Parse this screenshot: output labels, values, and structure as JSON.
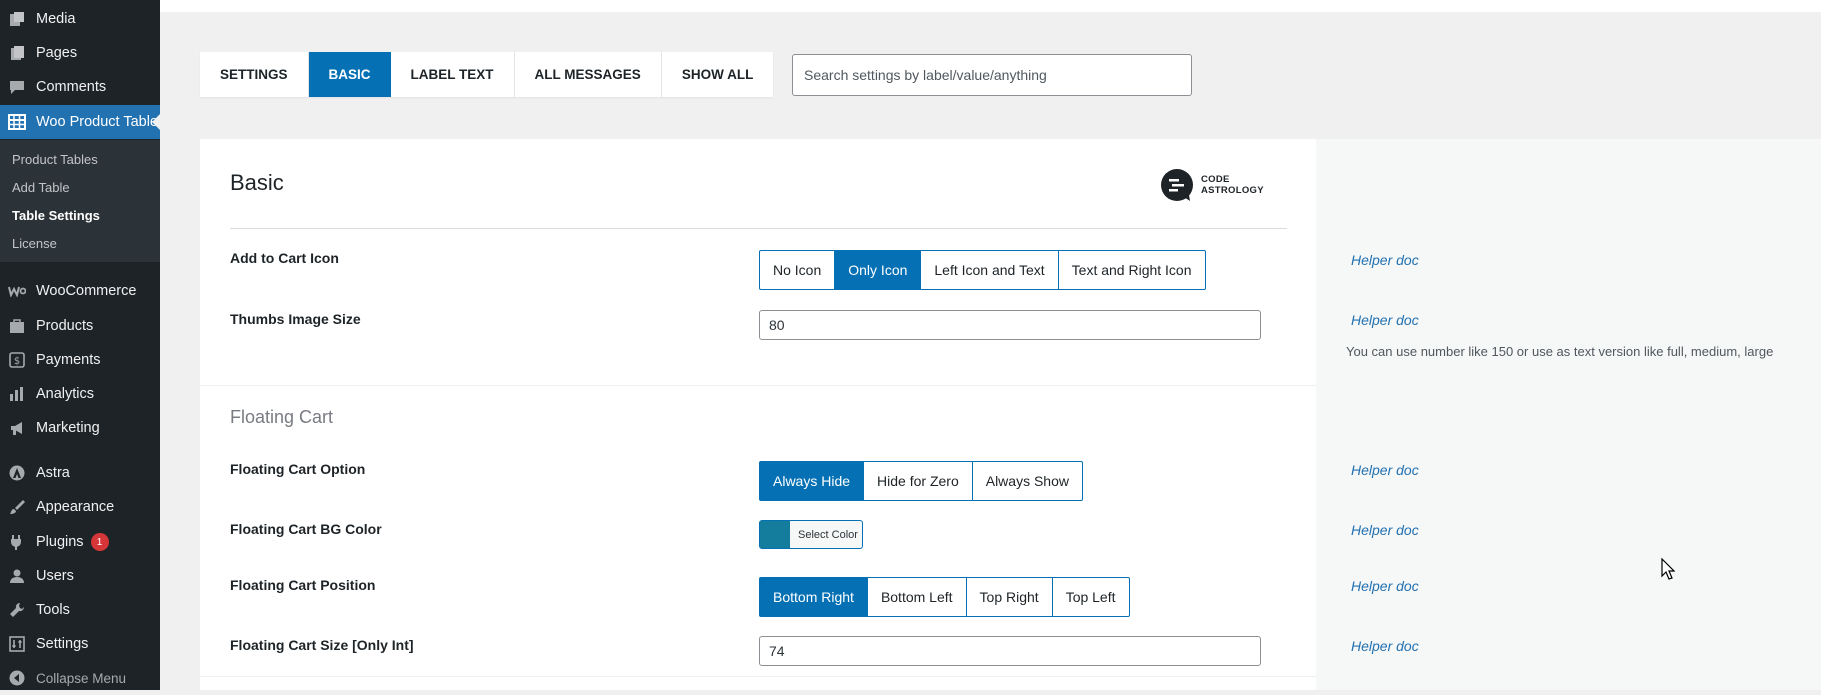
{
  "sidebar": {
    "items": [
      {
        "label": "Media",
        "icon": "media-icon"
      },
      {
        "label": "Pages",
        "icon": "pages-icon"
      },
      {
        "label": "Comments",
        "icon": "comments-icon"
      },
      {
        "label": "Woo Product Table",
        "icon": "table-icon"
      },
      {
        "label": "WooCommerce",
        "icon": "woocommerce-icon"
      },
      {
        "label": "Products",
        "icon": "products-icon"
      },
      {
        "label": "Payments",
        "icon": "payments-icon"
      },
      {
        "label": "Analytics",
        "icon": "analytics-icon"
      },
      {
        "label": "Marketing",
        "icon": "marketing-icon"
      },
      {
        "label": "Astra",
        "icon": "astra-icon"
      },
      {
        "label": "Appearance",
        "icon": "appearance-icon"
      },
      {
        "label": "Plugins",
        "icon": "plugins-icon",
        "badge": "1"
      },
      {
        "label": "Users",
        "icon": "users-icon"
      },
      {
        "label": "Tools",
        "icon": "tools-icon"
      },
      {
        "label": "Settings",
        "icon": "settings-icon"
      },
      {
        "label": "Collapse Menu",
        "icon": "collapse-icon"
      }
    ],
    "submenu": [
      "Product Tables",
      "Add Table",
      "Table Settings",
      "License"
    ]
  },
  "tabs": [
    "SETTINGS",
    "BASIC",
    "LABEL TEXT",
    "ALL MESSAGES",
    "SHOW ALL"
  ],
  "search": {
    "placeholder": "Search settings by label/value/anything"
  },
  "basic": {
    "title": "Basic",
    "logo_text_1": "CODE",
    "logo_text_2": "ASTROLOGY",
    "add_to_cart_icon": {
      "label": "Add to Cart Icon",
      "options": [
        "No Icon",
        "Only Icon",
        "Left Icon and Text",
        "Text and Right Icon"
      ],
      "selected": "Only Icon"
    },
    "thumbs_image_size": {
      "label": "Thumbs Image Size",
      "value": "80",
      "hint": "You can use number like 150 or use as text version like full, medium, large"
    }
  },
  "floating_cart": {
    "title": "Floating Cart",
    "option": {
      "label": "Floating Cart Option",
      "options": [
        "Always Hide",
        "Hide for Zero",
        "Always Show"
      ],
      "selected": "Always Hide"
    },
    "bg_color": {
      "label": "Floating Cart BG Color",
      "button": "Select Color",
      "color": "#147d9d"
    },
    "position": {
      "label": "Floating Cart Position",
      "options": [
        "Bottom Right",
        "Bottom Left",
        "Top Right",
        "Top Left"
      ],
      "selected": "Bottom Right"
    },
    "size": {
      "label": "Floating Cart Size [Only Int]",
      "value": "74"
    }
  },
  "helper_label": "Helper doc",
  "colors": {
    "accent": "#0571b4",
    "sidebar": "#1d2327",
    "link": "#2271b1"
  }
}
